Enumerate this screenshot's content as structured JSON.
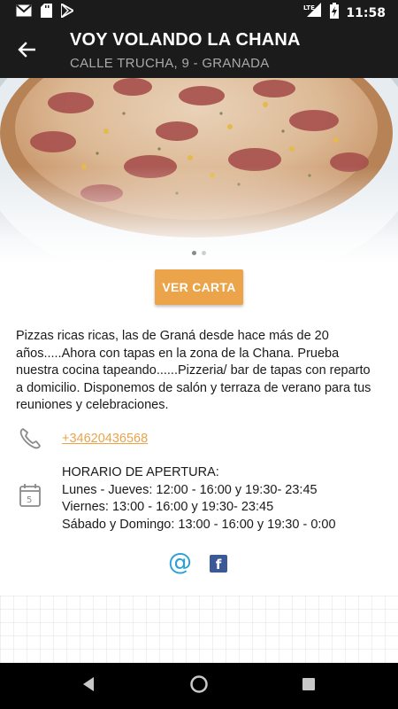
{
  "status_bar": {
    "time": "11:58",
    "left_icons": [
      "gmail-icon",
      "sd-card-icon",
      "play-store-icon"
    ],
    "right_icons": [
      "lte-signal-icon",
      "battery-charging-icon"
    ],
    "network": "LTE"
  },
  "app_bar": {
    "title": "VOY VOLANDO LA CHANA",
    "subtitle": "CALLE TRUCHA, 9 - GRANADA",
    "back_icon": "arrow-back-icon"
  },
  "hero": {
    "image": "pizza-photo",
    "pages": 2,
    "active_page": 1
  },
  "menu_button": {
    "label": "VER CARTA",
    "color": "#eba44a"
  },
  "description": "Pizzas ricas ricas, las de Graná desde hace más de 20 años.....Ahora con tapas en la zona de la Chana. Prueba nuestra cocina tapeando......Pizzeria/ bar de tapas con reparto a domicilio. Disponemos de salón y terraza de verano para tus reuniones y celebraciones.",
  "contact": {
    "phone": "+34620436568",
    "phone_icon": "phone-icon"
  },
  "hours": {
    "icon": "calendar-icon",
    "lines": [
      "HORARIO DE APERTURA:",
      "Lunes - Jueves: 12:00 - 16:00 y 19:30- 23:45",
      "Viernes: 13:00 - 16:00 y 19:30- 23:45",
      "Sábado y Domingo: 13:00 - 16:00 y 19:30 - 0:00"
    ]
  },
  "social": {
    "email_glyph": "@",
    "facebook_glyph": "f",
    "email_color": "#2a9fd9",
    "facebook_color": "#3b5998"
  },
  "nav_bar": {
    "buttons": [
      "back-triangle-icon",
      "home-circle-icon",
      "recents-square-icon"
    ]
  }
}
